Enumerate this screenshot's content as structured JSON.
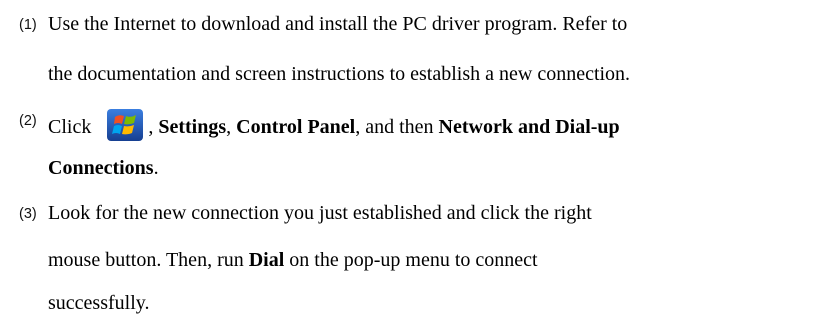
{
  "steps": [
    {
      "number": "(1)",
      "line1": "Use the Internet to download and install the PC driver program. Refer to",
      "line2": "the documentation and screen instructions to establish a new connection."
    },
    {
      "number": "(2)",
      "click": "Click",
      "icon": "windows-start-icon",
      "sep1": ",",
      "settings": "Settings",
      "sep2": ",",
      "control_panel": "Control Panel",
      "and_then": ", and then",
      "network": "Network and Dial-up",
      "connections": "Connections",
      "period": "."
    },
    {
      "number": "(3)",
      "line1": "Look for the new connection you just established and click the right",
      "line2_pre": "mouse button. Then, run",
      "dial": "Dial",
      "line2_post": "on the pop-up menu to connect",
      "line3": "successfully."
    }
  ],
  "colors": {
    "text": "#000000",
    "icon_orange": "#f25022",
    "icon_green": "#7fba00",
    "icon_blue": "#00a4ef",
    "icon_yellow": "#ffb900",
    "icon_bg": "#1f5fbf"
  }
}
